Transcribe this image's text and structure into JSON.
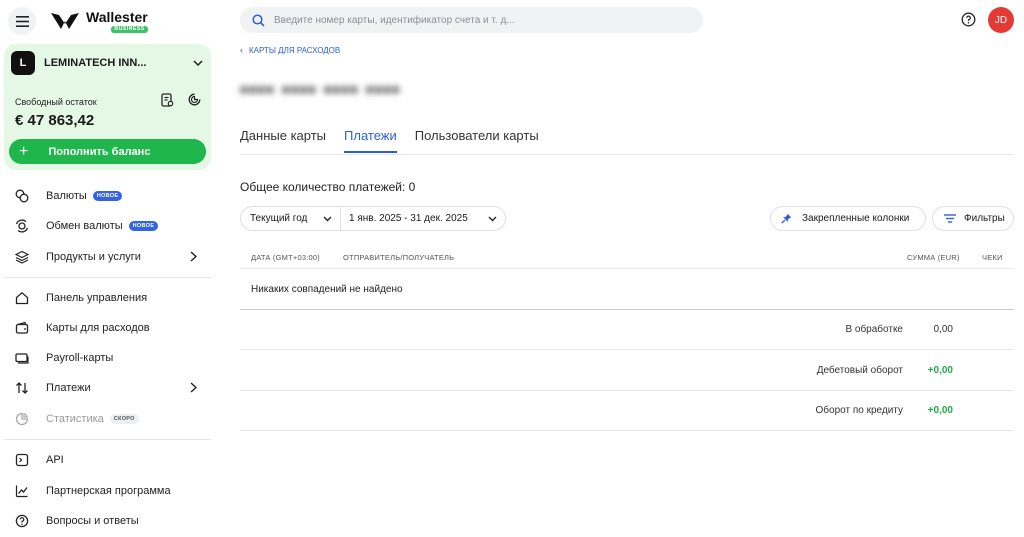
{
  "brand": {
    "name": "Wallester",
    "badge": "BUSINESS"
  },
  "account": {
    "avatar_letter": "L",
    "name": "LEMINATECH INN...",
    "balance_label": "Свободный остаток",
    "balance": "€ 47 863,42",
    "topup_label": "Пополнить баланс",
    "accent": "#e5f8e5",
    "button_color": "#1fb64b"
  },
  "nav": {
    "currencies": {
      "label": "Валюты",
      "badge": "НОВОЕ",
      "icon": "coins-icon"
    },
    "exchange": {
      "label": "Обмен валюты",
      "badge": "НОВОЕ",
      "icon": "exchange-icon"
    },
    "products": {
      "label": "Продукты и услуги",
      "icon": "layers-icon"
    },
    "dashboard": {
      "label": "Панель управления",
      "icon": "home-icon"
    },
    "cards": {
      "label": "Карты для расходов",
      "icon": "wallet-icon"
    },
    "payroll": {
      "label": "Payroll-карты",
      "icon": "cards-icon"
    },
    "payments": {
      "label": "Платежи",
      "icon": "arrows-updown-icon"
    },
    "stats": {
      "label": "Статистика",
      "badge": "СКОРО",
      "icon": "stats-icon"
    },
    "api": {
      "label": "API",
      "icon": "terminal-icon"
    },
    "partner": {
      "label": "Партнерская программа",
      "icon": "chart-up-icon"
    },
    "faq": {
      "label": "Вопросы и ответы",
      "icon": "question-icon"
    }
  },
  "search": {
    "placeholder": "Введите номер карты, идентификатор счета и т. д..."
  },
  "user": {
    "initials": "JD",
    "color": "#e53935"
  },
  "breadcrumb": "КАРТЫ ДЛЯ РАСХОДОВ",
  "tabs": {
    "card_data": "Данные карты",
    "payments": "Платежи",
    "card_users": "Пользователи карты",
    "active": "payments"
  },
  "payments": {
    "total_label": "Общее количество платежей: 0",
    "period_select": "Текущий год",
    "date_range": "1 янв. 2025 - 31 дек. 2025",
    "pinned_columns": "Закрепленные колонки",
    "filters": "Фильтры",
    "columns": {
      "date": "ДАТА (GMT+03:00)",
      "party": "ОТПРАВИТЕЛЬ/ПОЛУЧАТЕЛЬ",
      "amount": "СУММА (EUR)",
      "receipts": "ЧЕКИ"
    },
    "empty_text": "Никаких совпадений не найдено",
    "summary": {
      "processing_label": "В обработке",
      "processing_value": "0,00",
      "debit_label": "Дебетовый оборот",
      "debit_value": "+0,00",
      "credit_label": "Оборот по кредиту",
      "credit_value": "+0,00"
    }
  }
}
